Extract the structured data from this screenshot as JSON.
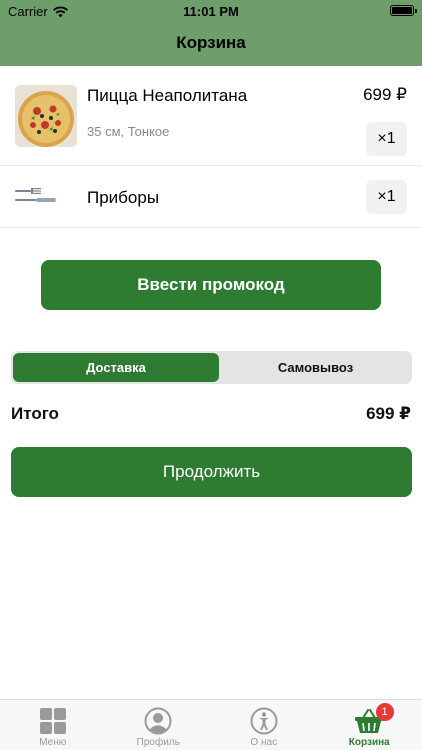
{
  "status_bar": {
    "carrier": "Carrier",
    "time": "11:01 PM"
  },
  "nav": {
    "title": "Корзина"
  },
  "cart": {
    "items": [
      {
        "name": "Пицца Неаполитана",
        "description": "35 см, Тонкое",
        "price": "699 ₽",
        "quantity": "×1",
        "icon": "pizza-image"
      },
      {
        "name": "Приборы",
        "quantity": "×1",
        "icon": "cutlery-icon"
      }
    ]
  },
  "promo": {
    "label": "Ввести промокод"
  },
  "delivery": {
    "options": [
      "Доставка",
      "Самовывоз"
    ],
    "selected": "Доставка"
  },
  "total": {
    "label": "Итого",
    "value": "699 ₽"
  },
  "continue": {
    "label": "Продолжить"
  },
  "tabbar": {
    "tabs": [
      {
        "label": "Меню",
        "icon": "menu-grid-icon"
      },
      {
        "label": "Профиль",
        "icon": "profile-icon"
      },
      {
        "label": "О нас",
        "icon": "about-icon"
      },
      {
        "label": "Корзина",
        "icon": "basket-icon",
        "badge": "1",
        "active": true
      }
    ]
  },
  "colors": {
    "header": "#6e9e6c",
    "accent": "#2e7b32",
    "badge": "#e53935"
  }
}
